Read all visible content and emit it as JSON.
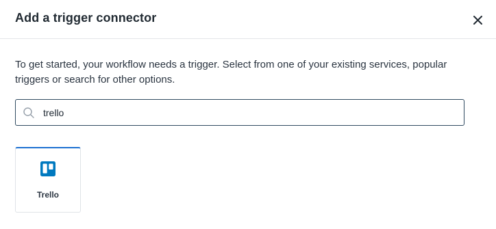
{
  "dialog": {
    "title": "Add a trigger connector",
    "close_icon": "close-icon"
  },
  "intro": {
    "text": "To get started, your workflow needs a trigger. Select from one of your existing services, popular triggers or search for other options."
  },
  "search": {
    "icon": "search-icon",
    "value": "trello",
    "border_color": "#2f4a60"
  },
  "results": [
    {
      "label": "Trello",
      "icon": "trello-icon",
      "brand_color": "#0079bf",
      "selected_accent": "#1b6fd1"
    }
  ]
}
